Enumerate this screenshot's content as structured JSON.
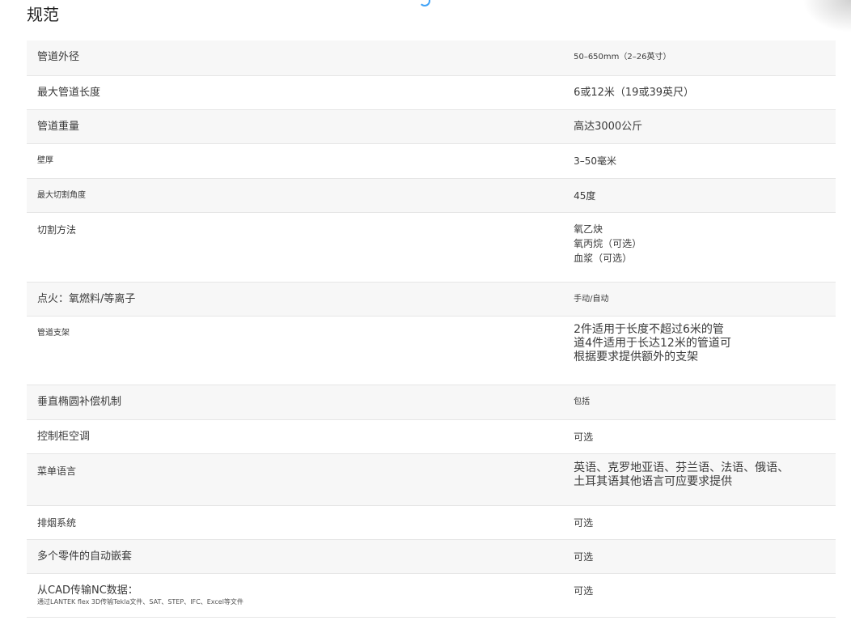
{
  "page": {
    "title": "规范"
  },
  "specs": [
    {
      "label": "管道外径",
      "value": "50–650mm（2–26英寸）"
    },
    {
      "label": "最大管道长度",
      "value": "6或12米（19或39英尺）"
    },
    {
      "label": "管道重量",
      "value": "高达3000公斤"
    },
    {
      "label": "壁厚",
      "value": "3–50毫米"
    },
    {
      "label": "最大切割角度",
      "value": "45度"
    },
    {
      "label": "切割方法",
      "value": "氧乙炔\n氧丙烷（可选）\n血浆（可选）"
    },
    {
      "label": "点火：氧燃料/等离子",
      "value": "手动/自动"
    },
    {
      "label": "管道支架",
      "value": "2件适用于长度不超过6米的管\n道4件适用于长达12米的管道可\n根据要求提供额外的支架"
    },
    {
      "label": "垂直椭圆补偿机制",
      "value": "包括"
    },
    {
      "label": "控制柜空调",
      "value": "可选"
    },
    {
      "label": "菜单语言",
      "value": "英语、克罗地亚语、芬兰语、法语、俄语、\n土耳其语其他语言可应要求提供"
    },
    {
      "label": "排烟系统",
      "value": "可选"
    },
    {
      "label": "多个零件的自动嵌套",
      "value": "可选"
    },
    {
      "label": "从CAD传输NC数据：",
      "sublabel": "通过LANTEK flex 3D传输Tekla文件、SAT、STEP、IFC、Excel等文件",
      "value": "可选"
    }
  ]
}
